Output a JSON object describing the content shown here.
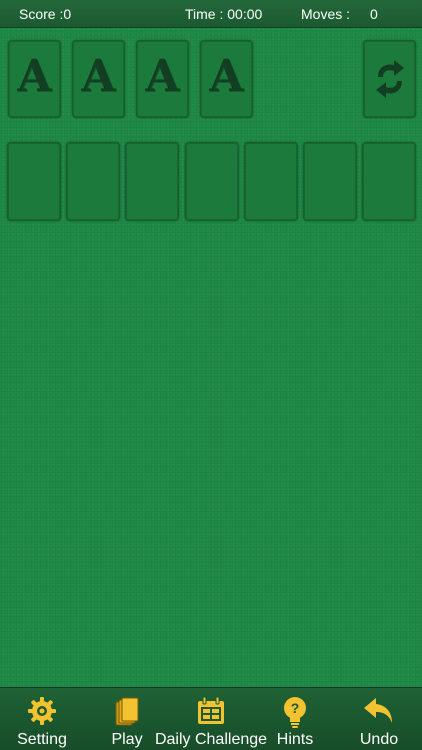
{
  "status": {
    "score_label": "Score :0",
    "time_label": "Time : 00:00",
    "moves_label": "Moves :",
    "moves_value": "0"
  },
  "foundations": [
    {
      "label": "A"
    },
    {
      "label": "A"
    },
    {
      "label": "A"
    },
    {
      "label": "A"
    }
  ],
  "stock": {
    "icon": "recycle-icon"
  },
  "tableau_columns": 7,
  "toolbar": {
    "setting_label": "Setting",
    "play_label": "Play",
    "daily_label": "Daily Challenge",
    "hints_label": "Hints",
    "undo_label": "Undo"
  },
  "colors": {
    "felt": "#1f8a47",
    "icon_yellow": "#f2c230",
    "slot_text": "#123f22"
  }
}
